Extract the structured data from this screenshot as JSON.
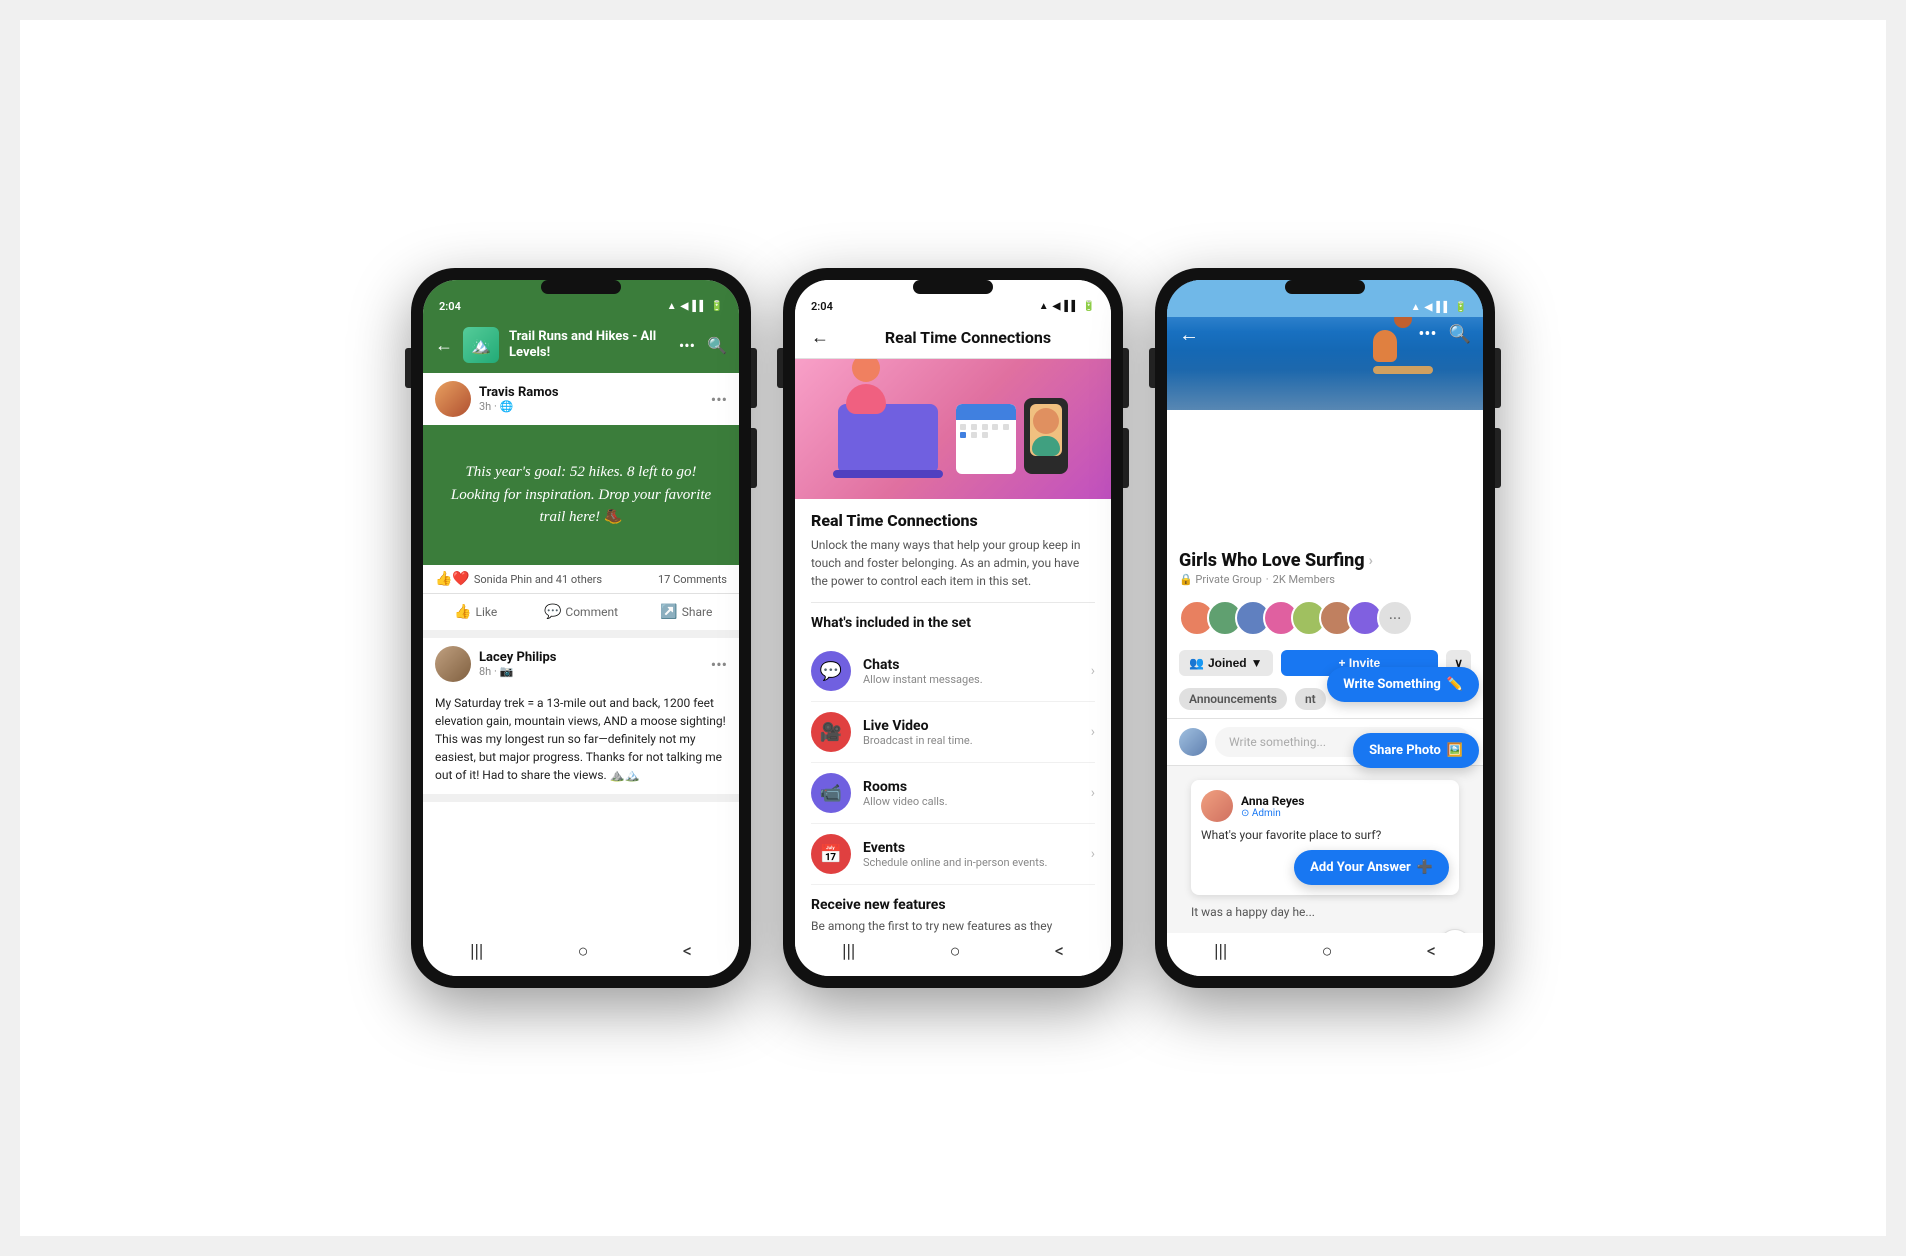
{
  "phone1": {
    "status": {
      "time": "2:04",
      "icons": "▲ ◀ ▌▌ 🔋"
    },
    "header": {
      "group_title": "Trail Runs and Hikes - All Levels!",
      "back_label": "←",
      "more_label": "•••",
      "search_label": "🔍"
    },
    "post1": {
      "author": "Travis Ramos",
      "meta": "3h · 🌐",
      "post_text": "This year's goal: 52 hikes. 8 left to go! Looking for inspiration. Drop your favorite trail here! 🥾",
      "reactions": "Sonida Phin and 41 others",
      "comments": "17 Comments",
      "like_label": "Like",
      "comment_label": "Comment",
      "share_label": "Share"
    },
    "post2": {
      "author": "Lacey Philips",
      "meta": "8h · 📷",
      "post_text": "My Saturday trek = a 13-mile out and back, 1200 feet elevation gain, mountain views, AND a moose sighting! This was my longest run so far—definitely not my easiest, but major progress. Thanks for not talking me out of it! Had to share the views. ⛰️🏔️"
    },
    "nav": {
      "lines": "|||",
      "home": "○",
      "back": "<"
    }
  },
  "phone2": {
    "status": {
      "time": "2:04"
    },
    "header": {
      "back_label": "←",
      "title": "Real Time Connections"
    },
    "section": {
      "title": "Real Time Connections",
      "description": "Unlock the many ways that help your group keep in touch and foster belonging. As an admin, you have the power to control each item in this set.",
      "features_title": "What's included in the set",
      "features": [
        {
          "name": "Chats",
          "desc": "Allow instant messages.",
          "icon": "💬",
          "icon_type": "chat"
        },
        {
          "name": "Live Video",
          "desc": "Broadcast in real time.",
          "icon": "📹",
          "icon_type": "live"
        },
        {
          "name": "Rooms",
          "desc": "Allow video calls.",
          "icon": "📹",
          "icon_type": "rooms"
        },
        {
          "name": "Events",
          "desc": "Schedule online and in-person events.",
          "icon": "📅",
          "icon_type": "events"
        }
      ],
      "receive_title": "Receive new features",
      "receive_desc": "Be among the first to try new features as they"
    },
    "nav": {
      "lines": "|||",
      "home": "○",
      "back": "<"
    }
  },
  "phone3": {
    "status": {
      "time": ""
    },
    "header": {
      "back_label": "←",
      "more_label": "•••",
      "search_label": "🔍"
    },
    "group": {
      "name": "Girls Who Love Surfing",
      "meta_privacy": "🔒 Private Group",
      "meta_members": "2K Members"
    },
    "actions": {
      "joined_label": "Joined",
      "invite_label": "+ Invite",
      "more_label": "∨"
    },
    "tabs": {
      "items": [
        "Announcements",
        "nt"
      ]
    },
    "write": {
      "placeholder": "Write something..."
    },
    "tooltips": {
      "write_something": "Write Something",
      "share_photo": "Share Photo",
      "add_answer": "Add Your Answer"
    },
    "question": {
      "author": "Anna Reyes",
      "admin": "⊙ Admin",
      "text": "What's your favorite place to surf?"
    },
    "post_preview": {
      "text": "It was a happy day he..."
    },
    "nav": {
      "lines": "|||",
      "home": "○",
      "back": "<"
    }
  }
}
